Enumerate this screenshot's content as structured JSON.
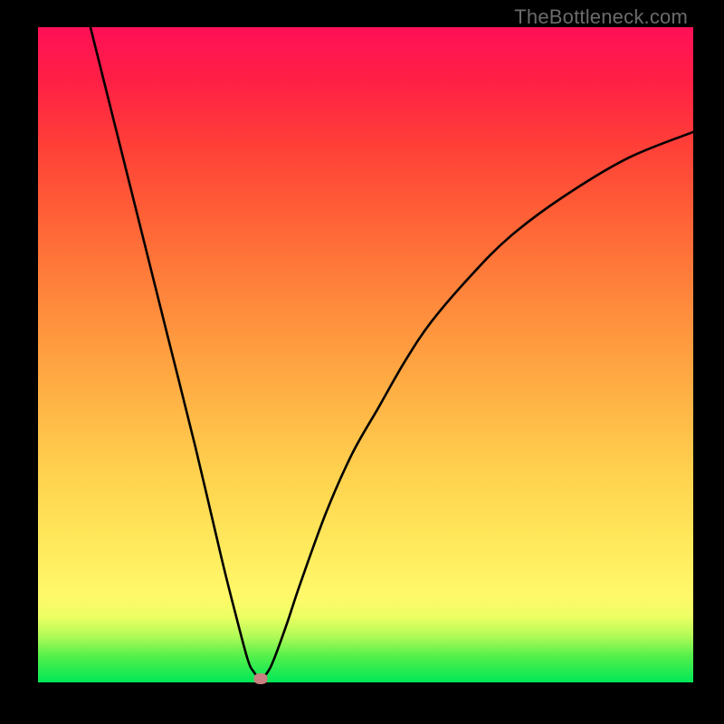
{
  "watermark": "TheBottleneck.com",
  "chart_data": {
    "type": "line",
    "title": "",
    "xlabel": "",
    "ylabel": "",
    "xlim": [
      0,
      100
    ],
    "ylim": [
      0,
      100
    ],
    "grid": false,
    "legend": false,
    "series": [
      {
        "name": "bottleneck-curve",
        "x": [
          8,
          12,
          16,
          20,
          24,
          28,
          30,
          32,
          33,
          34,
          35,
          36,
          38,
          40,
          44,
          48,
          52,
          56,
          60,
          66,
          72,
          80,
          90,
          100
        ],
        "y": [
          100,
          84,
          68,
          52,
          36,
          19,
          11,
          3.5,
          1.5,
          0.5,
          1.5,
          3.5,
          9,
          15,
          26,
          35,
          42,
          49,
          55,
          62,
          68,
          74,
          80,
          84
        ]
      }
    ],
    "minimum_marker": {
      "x": 34,
      "y": 0.5
    },
    "gradient_colors": {
      "bottom": "#00e756",
      "mid": "#ffd14e",
      "top": "#ff1057"
    }
  }
}
